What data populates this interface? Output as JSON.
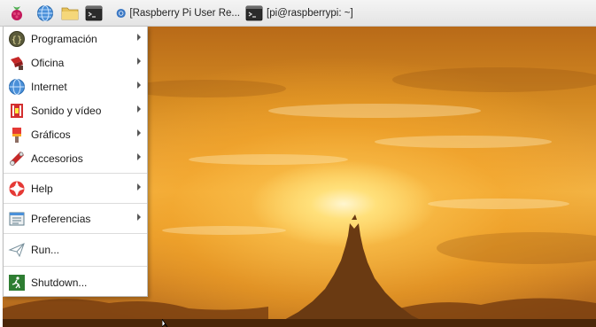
{
  "taskbar": {
    "launchers": [
      {
        "icon": "raspberry-icon",
        "label": ""
      },
      {
        "icon": "globe-icon",
        "label": ""
      },
      {
        "icon": "folder-icon",
        "label": ""
      },
      {
        "icon": "terminal-icon",
        "label": ""
      }
    ],
    "tasks": [
      {
        "icon": "chromium-icon",
        "label": "[Raspberry Pi User Re..."
      },
      {
        "icon": "terminal-icon",
        "label": "[pi@raspberrypi: ~]"
      }
    ]
  },
  "menu": {
    "items": [
      {
        "label": "Programación",
        "icon": "programming-icon",
        "submenu": true
      },
      {
        "label": "Oficina",
        "icon": "office-icon",
        "submenu": true
      },
      {
        "label": "Internet",
        "icon": "globe-icon",
        "submenu": true
      },
      {
        "label": "Sonido y vídeo",
        "icon": "multimedia-icon",
        "submenu": true
      },
      {
        "label": "Gráficos",
        "icon": "graphics-icon",
        "submenu": true
      },
      {
        "label": "Accesorios",
        "icon": "accessories-icon",
        "submenu": true
      },
      {
        "label": "Help",
        "icon": "help-icon",
        "submenu": true
      },
      {
        "label": "Preferencias",
        "icon": "preferences-icon",
        "submenu": true
      },
      {
        "label": "Run...",
        "icon": "run-icon",
        "submenu": false
      },
      {
        "label": "Shutdown...",
        "icon": "shutdown-icon",
        "submenu": false
      }
    ]
  },
  "colors": {
    "taskbar_bg": "#e9e9e9",
    "menu_bg": "#ffffff",
    "sky_gold": "#f2b649",
    "sun_glow": "#fff6d0"
  }
}
